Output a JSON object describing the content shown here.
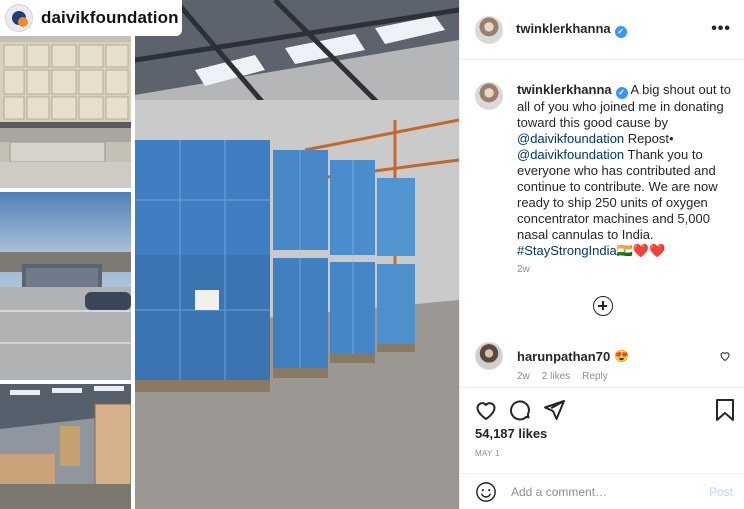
{
  "media": {
    "brand_name": "daivikfoundation",
    "photos": [
      {
        "name": "warehouse-shelves-photo"
      },
      {
        "name": "parking-lot-truck-photo"
      },
      {
        "name": "warehouse-interior-photo"
      },
      {
        "name": "wrapped-pallets-photo"
      }
    ]
  },
  "post": {
    "author": "twinklerkhanna",
    "more_icon": "more-options-icon",
    "caption": {
      "username": "twinklerkhanna",
      "text_1": " A big shout out to all of you who joined me in donating toward this good cause by ",
      "mention_1": "@daivikfoundation",
      "text_2": " Repost• ",
      "mention_2": "@daivikfoundation",
      "text_3": " Thank you to everyone who has contributed and continue to contribute. We are now ready to ship 250 units of oxygen concentrator machines and 5,000 nasal cannulas to India. ",
      "hashtag": "#StayStrongIndia",
      "emojis": "🇮🇳❤️❤️"
    },
    "caption_time": "2w",
    "load_more_icon": "plus-circle-icon",
    "comment": {
      "username": "harunpathan70",
      "emoji": "😍",
      "time": "2w",
      "likes": "2 likes",
      "reply": "Reply"
    },
    "likes": "54,187 likes",
    "date": "MAY 1",
    "add_comment": {
      "placeholder": "Add a comment…",
      "post_label": "Post"
    }
  },
  "colors": {
    "link": "#00376b",
    "verified": "#3897f0",
    "muted": "#8e8e8e",
    "post_button": "#b2dffc"
  }
}
